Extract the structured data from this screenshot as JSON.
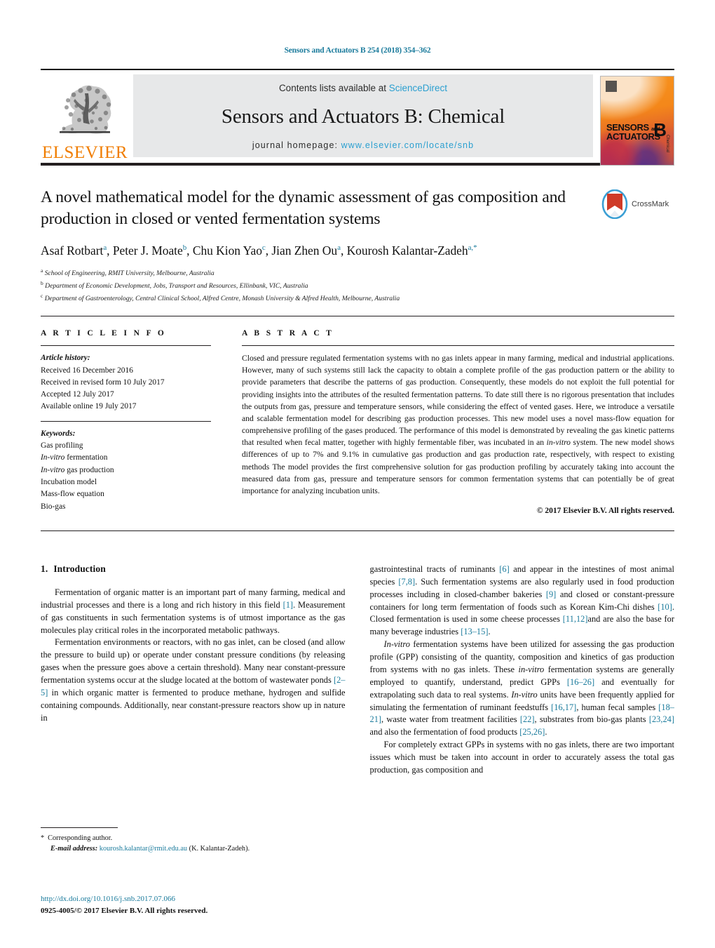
{
  "running_head": "Sensors and Actuators B 254 (2018) 354–362",
  "masthead": {
    "publisher_logo_text": "ELSEVIER",
    "contents_prefix": "Contents lists available at ",
    "contents_link": "ScienceDirect",
    "journal_name": "Sensors and Actuators B: Chemical",
    "homepage_prefix": "journal homepage: ",
    "homepage_url": "www.elsevier.com/locate/snb",
    "cover": {
      "line1": "SENSORS",
      "line1_small": "and",
      "line2": "ACTUATORS",
      "letter": "B",
      "vertical": "Chemical"
    }
  },
  "crossmark": {
    "label": "CrossMark"
  },
  "title": "A novel mathematical model for the dynamic assessment of gas composition and production in closed or vented fermentation systems",
  "authors": [
    {
      "name": "Asaf Rotbart",
      "sup": "a"
    },
    {
      "name": "Peter J. Moate",
      "sup": "b"
    },
    {
      "name": "Chu Kion Yao",
      "sup": "c"
    },
    {
      "name": "Jian Zhen Ou",
      "sup": "a"
    },
    {
      "name": "Kourosh Kalantar-Zadeh",
      "sup": "a,*"
    }
  ],
  "affiliations": [
    {
      "marker": "a",
      "text": "School of Engineering, RMIT University, Melbourne, Australia"
    },
    {
      "marker": "b",
      "text": "Department of Economic Development, Jobs, Transport and Resources, Ellinbank, VIC, Australia"
    },
    {
      "marker": "c",
      "text": "Department of Gastroenterology, Central Clinical School, Alfred Centre, Monash University & Alfred Health, Melbourne, Australia"
    }
  ],
  "article_info": {
    "heading": "A R T I C L E   I N F O",
    "history_label": "Article history:",
    "history": [
      "Received 16 December 2016",
      "Received in revised form 10 July 2017",
      "Accepted 12 July 2017",
      "Available online 19 July 2017"
    ],
    "keywords_label": "Keywords:",
    "keywords": [
      {
        "text": "Gas profiling",
        "italic_prefix": ""
      },
      {
        "text": "fermentation",
        "italic_prefix": "In-vitro"
      },
      {
        "text": "gas production",
        "italic_prefix": "In-vitro"
      },
      {
        "text": "Incubation model",
        "italic_prefix": ""
      },
      {
        "text": "Mass-flow equation",
        "italic_prefix": ""
      },
      {
        "text": "Bio-gas",
        "italic_prefix": ""
      }
    ]
  },
  "abstract": {
    "heading": "A B S T R A C T",
    "part1": "Closed and pressure regulated fermentation systems with no gas inlets appear in many farming, medical and industrial applications. However, many of such systems still lack the capacity to obtain a complete profile of the gas production pattern or the ability to provide parameters that describe the patterns of gas production. Consequently, these models do not exploit the full potential for providing insights into the attributes of the resulted fermentation patterns. To date still there is no rigorous presentation that includes the outputs from gas, pressure and temperature sensors, while considering the effect of vented gases. Here, we introduce a versatile and scalable fermentation model for describing gas production processes. This new model uses a novel mass-flow equation for comprehensive profiling of the gases produced. The performance of this model is demonstrated by revealing the gas kinetic patterns that resulted when fecal matter, together with highly fermentable fiber, was incubated in an ",
    "italic1": "in-vitro",
    "part2": " system. The new model shows differences of up to 7% and 9.1% in cumulative gas production and gas production rate, respectively, with respect to existing methods The model provides the first comprehensive solution for gas production profiling by accurately taking into account the measured data from gas, pressure and temperature sensors for common fermentation systems that can potentially be of great importance for analyzing incubation units.",
    "copyright": "© 2017 Elsevier B.V. All rights reserved."
  },
  "sections": {
    "intro_number": "1.",
    "intro_title": "Introduction"
  },
  "body": {
    "left": {
      "p1_a": "Fermentation of organic matter is an important part of many farming, medical and industrial processes and there is a long and rich history in this field ",
      "p1_ref1": "[1]",
      "p1_b": ". Measurement of gas constituents in such fermentation systems is of utmost importance as the gas molecules play critical roles in the incorporated metabolic pathways.",
      "p2_a": "Fermentation environments or reactors, with no gas inlet, can be closed (and allow the pressure to build up) or operate under constant pressure conditions (by releasing gases when the pressure goes above a certain threshold). Many near constant-pressure fermentation systems occur at the sludge located at the bottom of wastewater ponds ",
      "p2_ref1": "[2–5]",
      "p2_b": " in which organic matter is fermented to produce methane, hydrogen and sulfide containing compounds. Additionally, near constant-pressure reactors show up in nature in"
    },
    "right": {
      "p1_a": "gastrointestinal tracts of ruminants ",
      "p1_ref1": "[6]",
      "p1_b": " and appear in the intestines of most animal species ",
      "p1_ref2": "[7,8]",
      "p1_c": ". Such fermentation systems are also regularly used in food production processes including in closed-chamber bakeries ",
      "p1_ref3": "[9]",
      "p1_d": " and closed or constant-pressure containers for long term fermentation of foods such as Korean Kim-Chi dishes ",
      "p1_ref4": "[10]",
      "p1_e": ". Closed fermentation is used in some cheese processes ",
      "p1_ref5": "[11,12]",
      "p1_f": "and are also the base for many beverage industries ",
      "p1_ref6": "[13–15]",
      "p1_g": ".",
      "p2_ital": "In-vitro",
      "p2_a": " fermentation systems have been utilized for assessing the gas production profile (GPP) consisting of the quantity, composition and kinetics of gas production from systems with no gas inlets. These ",
      "p2_ital2": "in-vitro",
      "p2_b": " fermentation systems are generally employed to quantify, understand, predict GPPs ",
      "p2_ref1": "[16–26]",
      "p2_c": " and eventually for extrapolating such data to real systems. ",
      "p2_ital3": "In-vitro",
      "p2_d": " units have been frequently applied for simulating the fermentation of ruminant feedstuffs ",
      "p2_ref2": "[16,17]",
      "p2_e": ", human fecal samples ",
      "p2_ref3": "[18–21]",
      "p2_f": ", waste water from treatment facilities ",
      "p2_ref4": "[22]",
      "p2_g": ", substrates from bio-gas plants ",
      "p2_ref5": "[23,24]",
      "p2_h": " and also the fermentation of food products ",
      "p2_ref6": "[25,26]",
      "p2_i": ".",
      "p3": "For completely extract GPPs in systems with no gas inlets, there are two important issues which must be taken into account in order to accurately assess the total gas production, gas composition and"
    }
  },
  "footnote": {
    "star": "*",
    "corresponding": "Corresponding author.",
    "email_label": "E-mail address:",
    "email": "kourosh.kalantar@rmit.edu.au",
    "email_suffix": " (K. Kalantar-Zadeh)."
  },
  "bottom": {
    "doi": "http://dx.doi.org/10.1016/j.snb.2017.07.066",
    "issn_line": "0925-4005/© 2017 Elsevier B.V. All rights reserved."
  },
  "colors": {
    "link": "#1b7b9c",
    "sciencedirect": "#2a9fd0",
    "elsevier_orange": "#f07d00",
    "rule": "#231f20"
  }
}
